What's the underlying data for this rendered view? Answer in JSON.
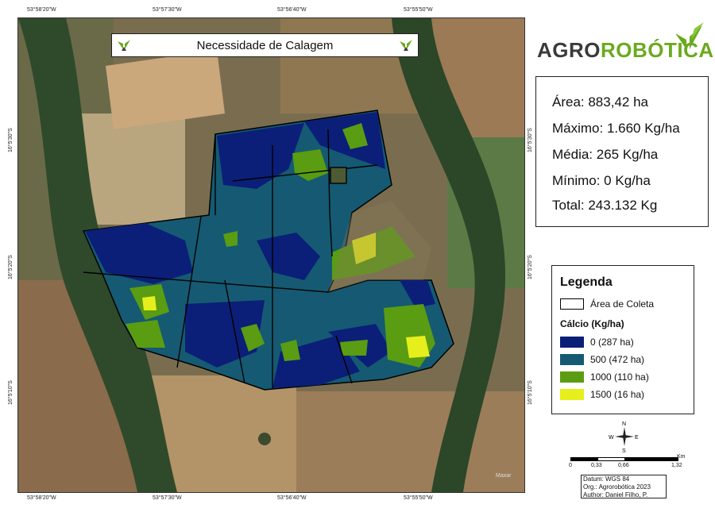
{
  "map": {
    "title": "Necessidade de Calagem",
    "coords_top": [
      "53°58'20\"W",
      "53°57'30\"W",
      "53°56'40\"W",
      "53°55'50\"W"
    ],
    "coords_bottom": [
      "53°58'20\"W",
      "53°57'30\"W",
      "53°56'40\"W",
      "53°55'50\"W"
    ],
    "coords_left": [
      "16°5'30\"S",
      "16°5'20\"S",
      "16°5'10\"S"
    ],
    "coords_right": [
      "16°5'30\"S",
      "16°5'20\"S",
      "16°5'10\"S"
    ],
    "watermark": "Maxar"
  },
  "logo": {
    "text_dark": "AGRO",
    "text_green": "ROBÓTICA",
    "dark_color": "#3a3a3a",
    "green_color": "#6aaa1e"
  },
  "stats": {
    "area": "Área: 883,42 ha",
    "max": "Máximo: 1.660 Kg/ha",
    "mean": "Média: 265 Kg/ha",
    "min": "Mínimo: 0 Kg/ha",
    "total": "Total: 243.132 Kg"
  },
  "legend": {
    "title": "Legenda",
    "boundary_label": "Área de Coleta",
    "subtitle": "Cálcio (Kg/ha)",
    "classes": [
      {
        "label": "0  (287 ha)",
        "color": "#0b1f78"
      },
      {
        "label": "500  (472 ha)",
        "color": "#155a72"
      },
      {
        "label": "1000  (110 ha)",
        "color": "#5a9c12"
      },
      {
        "label": "1500  (16 ha)",
        "color": "#e6ef1b"
      }
    ]
  },
  "compass": {
    "n": "N",
    "s": "S",
    "e": "E",
    "w": "W"
  },
  "scale": {
    "unit": "Km",
    "ticks": [
      "0",
      "0,33",
      "0,66",
      "1,32"
    ]
  },
  "credits": {
    "datum": "Datum: WGS 84",
    "org": "Org.: Agrorobótica 2023",
    "author": "Author: Daniel Filho, P."
  }
}
